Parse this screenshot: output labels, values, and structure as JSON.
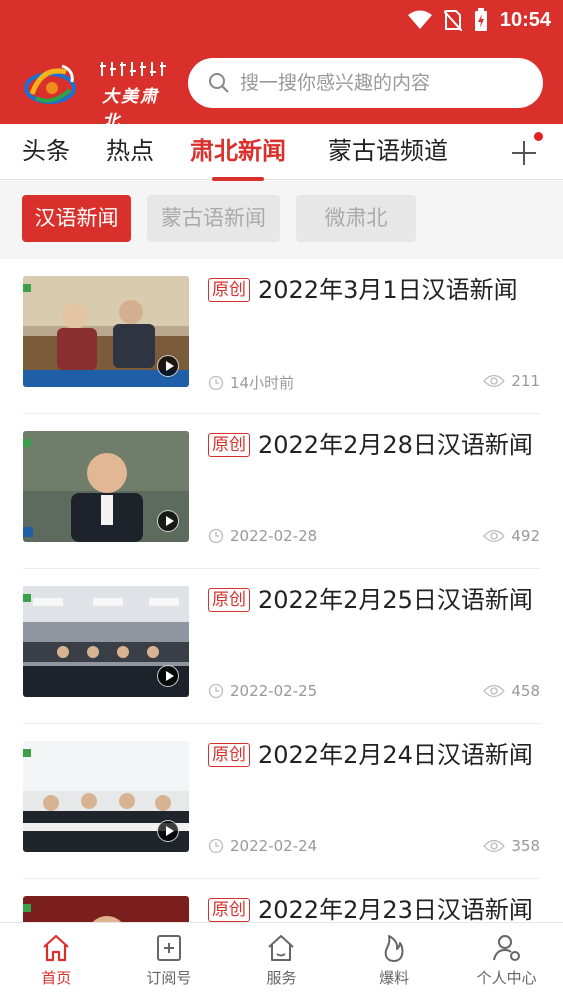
{
  "status_bar": {
    "time": "10:54"
  },
  "header": {
    "logo_text": "大美肃北",
    "search_placeholder": "搜一搜你感兴趣的内容"
  },
  "channels": {
    "items": [
      {
        "label": "头条"
      },
      {
        "label": "热点"
      },
      {
        "label": "肃北新闻",
        "active": true
      },
      {
        "label": "蒙古语频道"
      }
    ]
  },
  "subtabs": {
    "items": [
      {
        "label": "汉语新闻",
        "active": true
      },
      {
        "label": "蒙古语新闻"
      },
      {
        "label": "微肃北"
      }
    ]
  },
  "news": [
    {
      "tag": "原创",
      "title": "2022年3月1日汉语新闻",
      "time": "14小时前",
      "views": "211"
    },
    {
      "tag": "原创",
      "title": "2022年2月28日汉语新闻",
      "time": "2022-02-28",
      "views": "492"
    },
    {
      "tag": "原创",
      "title": "2022年2月25日汉语新闻",
      "time": "2022-02-25",
      "views": "458"
    },
    {
      "tag": "原创",
      "title": "2022年2月24日汉语新闻",
      "time": "2022-02-24",
      "views": "358"
    },
    {
      "tag": "原创",
      "title": "2022年2月23日汉语新闻",
      "time": "",
      "views": ""
    }
  ],
  "bottom_nav": {
    "items": [
      {
        "label": "首页",
        "icon": "home-icon",
        "active": true
      },
      {
        "label": "订阅号",
        "icon": "subscribe-icon"
      },
      {
        "label": "服务",
        "icon": "service-icon"
      },
      {
        "label": "爆料",
        "icon": "fire-icon"
      },
      {
        "label": "个人中心",
        "icon": "user-settings-icon"
      }
    ]
  },
  "colors": {
    "brand": "#d9302c",
    "text": "#222222",
    "muted": "#999999"
  }
}
